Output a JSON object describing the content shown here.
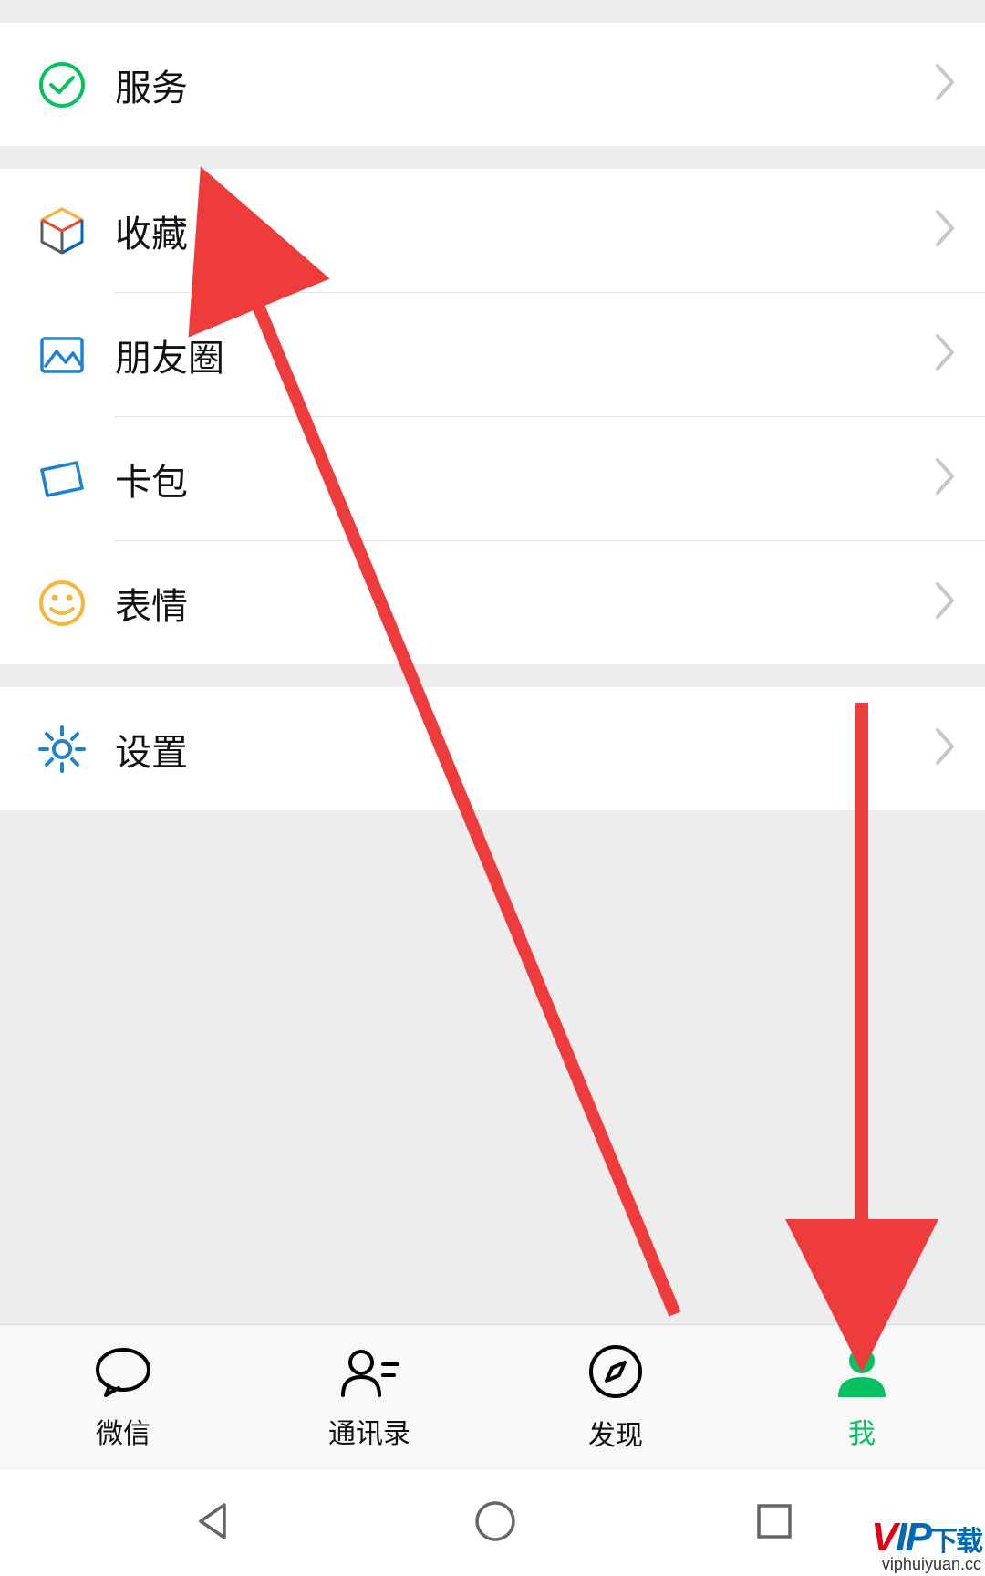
{
  "menu": {
    "services": {
      "label": "服务"
    },
    "favorites": {
      "label": "收藏"
    },
    "moments": {
      "label": "朋友圈"
    },
    "cards": {
      "label": "卡包"
    },
    "stickers": {
      "label": "表情"
    },
    "settings": {
      "label": "设置"
    }
  },
  "tabs": {
    "chats": {
      "label": "微信"
    },
    "contacts": {
      "label": "通讯录"
    },
    "discover": {
      "label": "发现"
    },
    "me": {
      "label": "我"
    }
  },
  "watermark": {
    "brand_v": "V",
    "brand_ip": "IP",
    "brand_suffix": "下载",
    "url": "viphuiyuan.cc"
  },
  "colors": {
    "accent": "#07c160",
    "arrow": "#ee3b3b"
  }
}
